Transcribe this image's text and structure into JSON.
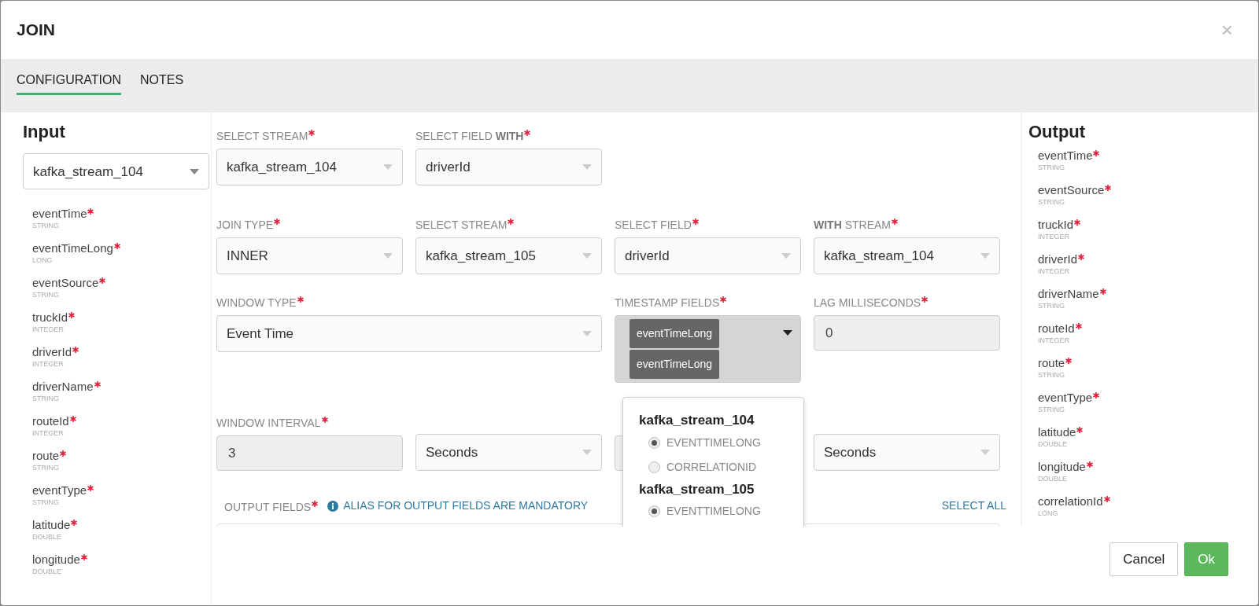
{
  "dialog": {
    "title": "JOIN",
    "close": "×"
  },
  "tabs": [
    {
      "label": "CONFIGURATION",
      "selected": true
    },
    {
      "label": "NOTES",
      "selected": false
    }
  ],
  "input": {
    "heading": "Input",
    "stream": "kafka_stream_104",
    "fields": [
      {
        "name": "eventTime",
        "type": "STRING",
        "required": true
      },
      {
        "name": "eventTimeLong",
        "type": "LONG",
        "required": true
      },
      {
        "name": "eventSource",
        "type": "STRING",
        "required": true
      },
      {
        "name": "truckId",
        "type": "INTEGER",
        "required": true
      },
      {
        "name": "driverId",
        "type": "INTEGER",
        "required": true
      },
      {
        "name": "driverName",
        "type": "STRING",
        "required": true
      },
      {
        "name": "routeId",
        "type": "INTEGER",
        "required": true
      },
      {
        "name": "route",
        "type": "STRING",
        "required": true
      },
      {
        "name": "eventType",
        "type": "STRING",
        "required": true
      },
      {
        "name": "latitude",
        "type": "DOUBLE",
        "required": true
      },
      {
        "name": "longitude",
        "type": "DOUBLE",
        "required": true
      }
    ]
  },
  "form": {
    "rows": [
      [
        {
          "label": "SELECT STREAM",
          "required": true,
          "kind": "select",
          "value": "kafka_stream_104"
        },
        {
          "label": "SELECT FIELD **WITH**",
          "required": true,
          "kind": "select",
          "value": "driverId"
        }
      ],
      [
        {
          "label": "JOIN TYPE",
          "required": true,
          "kind": "select",
          "value": "INNER"
        },
        {
          "label": "SELECT STREAM",
          "required": true,
          "kind": "select",
          "value": "kafka_stream_105"
        },
        {
          "label": "SELECT FIELD",
          "required": true,
          "kind": "select",
          "value": "driverId"
        },
        {
          "label": "**WITH** STREAM",
          "required": true,
          "kind": "select",
          "value": "kafka_stream_104"
        }
      ],
      [
        {
          "label": "WINDOW TYPE",
          "required": true,
          "kind": "select",
          "value": "Event Time",
          "wide": true
        },
        "",
        {
          "label": "TIMESTAMP FIELDS",
          "required": true,
          "kind": "multiselect",
          "tags": [
            "eventTimeLong",
            "eventTimeLong"
          ]
        },
        {
          "label": "LAG MILLISECONDS",
          "required": true,
          "kind": "input",
          "value": "0"
        }
      ],
      [
        {
          "label": "WINDOW INTERVAL",
          "required": true,
          "kind": "input",
          "value": "3"
        },
        {
          "kind": "select",
          "value": "Seconds"
        },
        {
          "kind": "input"
        },
        {
          "kind": "select",
          "value": "Seconds"
        }
      ]
    ],
    "output_fields": {
      "label": "OUTPUT FIELDS",
      "required": true,
      "note": "ALIAS FOR OUTPUT FIELDS ARE MANDATORY",
      "select_all": "SELECT ALL"
    },
    "dropdown": {
      "groups": [
        {
          "stream": "kafka_stream_104",
          "options": [
            {
              "label": "EVENTTIMELONG",
              "selected": true
            },
            {
              "label": "CORRELATIONID",
              "selected": false
            }
          ]
        },
        {
          "stream": "kafka_stream_105",
          "options": [
            {
              "label": "EVENTTIMELONG",
              "selected": true
            }
          ]
        }
      ]
    }
  },
  "output": {
    "heading": "Output",
    "fields": [
      {
        "name": "eventTime",
        "type": "STRING",
        "required": true
      },
      {
        "name": "eventSource",
        "type": "STRING",
        "required": true
      },
      {
        "name": "truckId",
        "type": "INTEGER",
        "required": true
      },
      {
        "name": "driverId",
        "type": "INTEGER",
        "required": true
      },
      {
        "name": "driverName",
        "type": "STRING",
        "required": true
      },
      {
        "name": "routeId",
        "type": "INTEGER",
        "required": true
      },
      {
        "name": "route",
        "type": "STRING",
        "required": true
      },
      {
        "name": "eventType",
        "type": "STRING",
        "required": true
      },
      {
        "name": "latitude",
        "type": "DOUBLE",
        "required": true
      },
      {
        "name": "longitude",
        "type": "DOUBLE",
        "required": true
      },
      {
        "name": "correlationId",
        "type": "LONG",
        "required": true
      }
    ]
  },
  "buttons": [
    {
      "label": "Cancel",
      "kind": "secondary"
    },
    {
      "label": "Ok",
      "kind": "primary"
    }
  ]
}
